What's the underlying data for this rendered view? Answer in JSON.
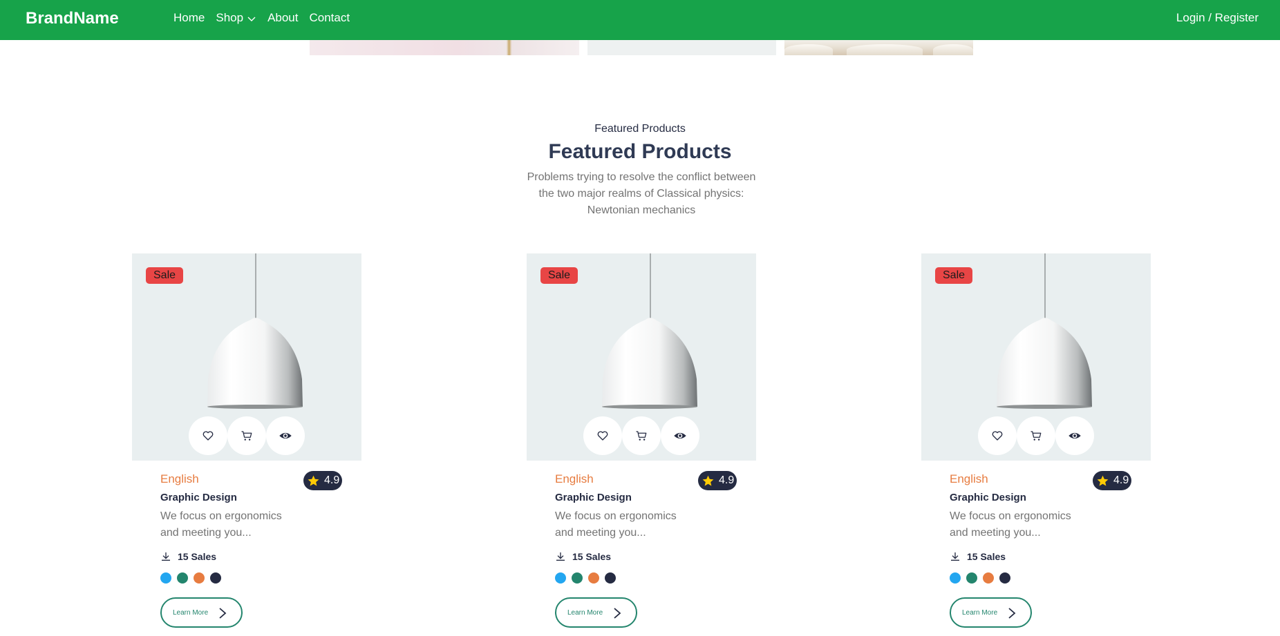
{
  "header": {
    "brand": "BrandName",
    "nav": [
      {
        "label": "Home"
      },
      {
        "label": "Shop",
        "has_dropdown": true
      },
      {
        "label": "About"
      },
      {
        "label": "Contact"
      }
    ],
    "login": "Login / Register",
    "bg_color": "#17a34a"
  },
  "section": {
    "eyebrow": "Featured Products",
    "title": "Featured Products",
    "description": "Problems trying to resolve the conflict between the two major realms of Classical physics: Newtonian mechanics"
  },
  "products": [
    {
      "badge": "Sale",
      "category": "English",
      "rating": "4.9",
      "title": "Graphic Design",
      "description": "We focus on ergonomics and meeting you...",
      "sales": "15 Sales",
      "colors": [
        "#23a6f0",
        "#23856d",
        "#e77c40",
        "#252b42"
      ],
      "cta": "Learn More",
      "actions": [
        "heart-icon",
        "cart-icon",
        "eye-icon"
      ]
    },
    {
      "badge": "Sale",
      "category": "English",
      "rating": "4.9",
      "title": "Graphic Design",
      "description": "We focus on ergonomics and meeting you...",
      "sales": "15 Sales",
      "colors": [
        "#23a6f0",
        "#23856d",
        "#e77c40",
        "#252b42"
      ],
      "cta": "Learn More",
      "actions": [
        "heart-icon",
        "cart-icon",
        "eye-icon"
      ]
    },
    {
      "badge": "Sale",
      "category": "English",
      "rating": "4.9",
      "title": "Graphic Design",
      "description": "We focus on ergonomics and meeting you...",
      "sales": "15 Sales",
      "colors": [
        "#23a6f0",
        "#23856d",
        "#e77c40",
        "#252b42"
      ],
      "cta": "Learn More",
      "actions": [
        "heart-icon",
        "cart-icon",
        "eye-icon"
      ]
    }
  ]
}
